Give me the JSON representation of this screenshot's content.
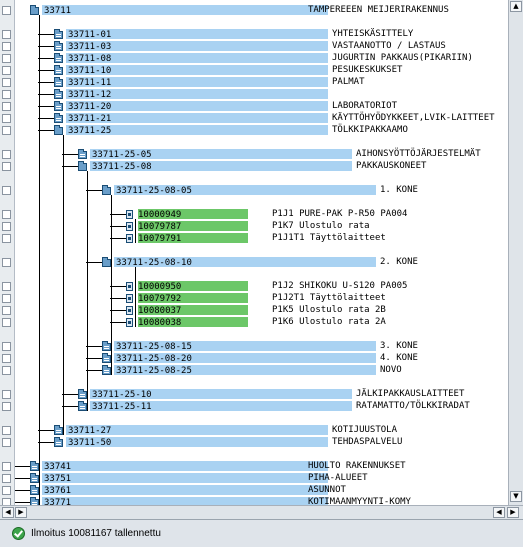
{
  "tree": {
    "root": {
      "id": "33711",
      "desc": "TAMPEREEEN MEIJERIRAKENNUS"
    },
    "nodes": [
      {
        "id": "33711-01",
        "desc": "YHTEISKÄSITTELY",
        "icon": "folder-closed"
      },
      {
        "id": "33711-03",
        "desc": "VASTAANOTTO / LASTAUS",
        "icon": "folder-closed"
      },
      {
        "id": "33711-08",
        "desc": "JUGURTIN PAKKAUS(PIKARIIN)",
        "icon": "folder-closed"
      },
      {
        "id": "33711-10",
        "desc": "PESUKESKUKSET",
        "icon": "folder-closed"
      },
      {
        "id": "33711-11",
        "desc": "PALMAT",
        "icon": "folder-closed"
      },
      {
        "id": "33711-12",
        "desc": "",
        "icon": "folder-closed"
      },
      {
        "id": "33711-20",
        "desc": "LABORATORIOT",
        "icon": "folder-closed"
      },
      {
        "id": "33711-21",
        "desc": "KÄYTTÖHYÖDYKKEET,LVIK-LAITTEET",
        "icon": "folder-closed"
      },
      {
        "id": "33711-25",
        "desc": "TÖLKKIPAKKAAMO",
        "icon": "folder-open"
      },
      {
        "id": "33711-25-05",
        "desc": "AIHONSYÖTTÖJÄRJESTELMÄT",
        "icon": "folder-closed"
      },
      {
        "id": "33711-25-08",
        "desc": "PAKKAUSKONEET",
        "icon": "folder-open"
      },
      {
        "id": "33711-25-08-05",
        "desc": "1. KONE",
        "icon": "folder-open"
      },
      {
        "id": "10000949",
        "desc": "P1J1 PURE-PAK P-R50 PA004",
        "icon": "equipment"
      },
      {
        "id": "10079787",
        "desc": "P1K7 Ulostulo rata",
        "icon": "equipment"
      },
      {
        "id": "10079791",
        "desc": "P1J1T1 Täyttölaitteet",
        "icon": "equipment"
      },
      {
        "id": "33711-25-08-10",
        "desc": "2. KONE",
        "icon": "folder-open"
      },
      {
        "id": "10000950",
        "desc": "P1J2 SHIKOKU U-S120 PA005",
        "icon": "equipment"
      },
      {
        "id": "10079792",
        "desc": "P1J2T1 Täyttölaitteet",
        "icon": "equipment"
      },
      {
        "id": "10080037",
        "desc": "P1K5 Ulostulo rata 2B",
        "icon": "equipment"
      },
      {
        "id": "10080038",
        "desc": "P1K6 Ulostulo rata 2A",
        "icon": "equipment"
      },
      {
        "id": "33711-25-08-15",
        "desc": "3. KONE",
        "icon": "folder-closed"
      },
      {
        "id": "33711-25-08-20",
        "desc": "4. KONE",
        "icon": "folder-closed"
      },
      {
        "id": "33711-25-08-25",
        "desc": "NOVO",
        "icon": "folder-closed"
      },
      {
        "id": "33711-25-10",
        "desc": "JÄLKIPAKKAUSLAITTEET",
        "icon": "folder-closed"
      },
      {
        "id": "33711-25-11",
        "desc": "RATAMATTO/TÖLKKIRADAT",
        "icon": "folder-closed"
      },
      {
        "id": "33711-27",
        "desc": "KOTIJUUSTOLA",
        "icon": "folder-closed"
      },
      {
        "id": "33711-50",
        "desc": "TEHDASPALVELU",
        "icon": "folder-closed"
      },
      {
        "id": "33741",
        "desc": "HUOLTO RAKENNUKSET",
        "icon": "folder-closed"
      },
      {
        "id": "33751",
        "desc": "PIHA-ALUEET",
        "icon": "folder-closed"
      },
      {
        "id": "33761",
        "desc": "ASUNNOT",
        "icon": "folder-closed"
      },
      {
        "id": "33771",
        "desc": "KOTIMAANMYYNTI-KOMY",
        "icon": "folder-closed"
      }
    ]
  },
  "scrollbars": {
    "left_arrow": "◀",
    "right_arrow": "▶",
    "up_arrow": "▲",
    "down_arrow": "▼"
  },
  "status_bar": {
    "message": "Ilmoitus 10081167 tallennettu",
    "type": "success"
  },
  "colors": {
    "node_bar": "#a9d2f2",
    "equipment_bar": "#6cc768",
    "gutter": "#e8ecef"
  }
}
